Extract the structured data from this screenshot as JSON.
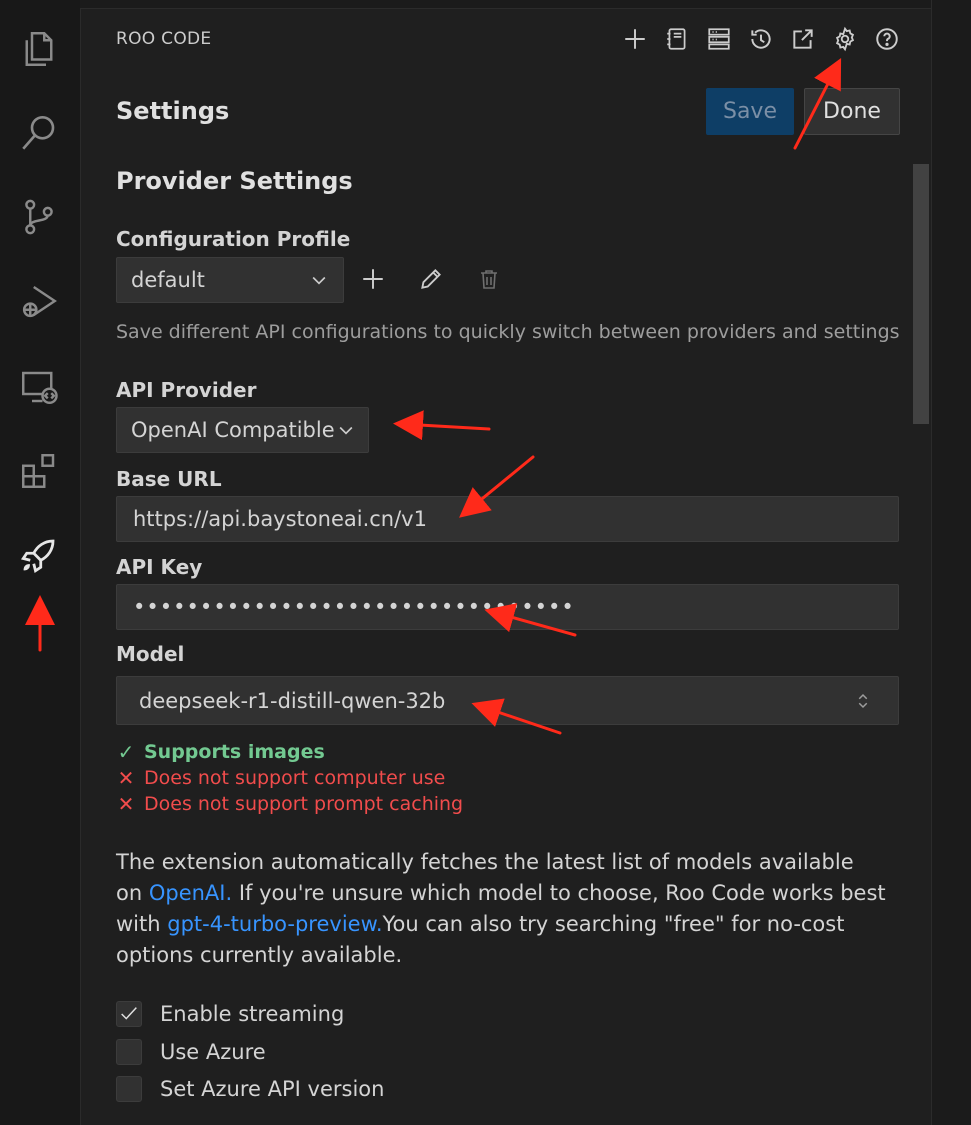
{
  "header": {
    "app_title": "ROO CODE",
    "toolbar_icons": [
      "plus-icon",
      "notebook-icon",
      "server-icon",
      "history-icon",
      "popout-icon",
      "gear-icon",
      "help-icon"
    ]
  },
  "settings": {
    "title": "Settings",
    "save_label": "Save",
    "done_label": "Done"
  },
  "provider": {
    "section_title": "Provider Settings",
    "profile_label": "Configuration Profile",
    "profile_value": "default",
    "profile_desc": "Save different API configurations to quickly switch between providers and settings",
    "api_provider_label": "API Provider",
    "api_provider_value": "OpenAI Compatible",
    "base_url_label": "Base URL",
    "base_url_value": "https://api.baystoneai.cn/v1",
    "api_key_label": "API Key",
    "api_key_value": "•••••••••••••••••••••••••••••••••",
    "model_label": "Model",
    "model_value": "deepseek-r1-distill-qwen-32b"
  },
  "capabilities": [
    {
      "mark": "✓",
      "text": "Supports images",
      "status": "ok"
    },
    {
      "mark": "✕",
      "text": "Does not support computer use",
      "status": "no"
    },
    {
      "mark": "✕",
      "text": "Does not support prompt caching",
      "status": "no"
    }
  ],
  "info": {
    "part1": "The extension automatically fetches the latest list of models available on ",
    "link1": "OpenAI.",
    "part2": " If you're unsure which model to choose, Roo Code works best with ",
    "link2": "gpt-4-turbo-preview.",
    "part3": "You can also try searching \"free\" for no-cost options currently available."
  },
  "options": [
    {
      "label": "Enable streaming",
      "checked": true
    },
    {
      "label": "Use Azure",
      "checked": false
    },
    {
      "label": "Set Azure API version",
      "checked": false
    }
  ],
  "colors": {
    "accent": "#0e3e66",
    "link": "#3794ff",
    "ok": "#73c991",
    "error": "#f14c4c",
    "annotation": "#ff2a1a"
  }
}
